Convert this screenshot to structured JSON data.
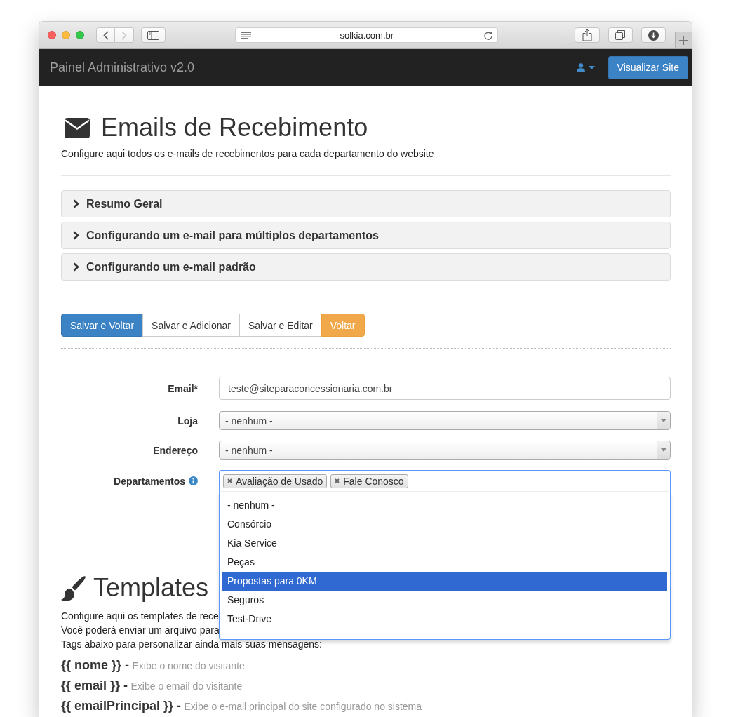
{
  "browser": {
    "url": "solkia.com.br",
    "forward_enabled": false
  },
  "navbar": {
    "brand": "Painel Administrativo v2.0",
    "button": "Visualizar Site"
  },
  "header": {
    "title": "Emails de Recebimento",
    "subtitle": "Configure aqui todos os e-mails de recebimentos para cada departamento do website"
  },
  "accordion": [
    {
      "label": "Resumo Geral",
      "expanded": false
    },
    {
      "label": "Configurando um e-mail para múltiplos departamentos",
      "expanded": false
    },
    {
      "label": "Configurando um e-mail padrão",
      "expanded": false
    }
  ],
  "actions": [
    {
      "label": "Salvar e Voltar",
      "kind": "primary"
    },
    {
      "label": "Salvar e Adicionar",
      "kind": "default"
    },
    {
      "label": "Salvar e Editar",
      "kind": "default"
    },
    {
      "label": "Voltar",
      "kind": "warning"
    }
  ],
  "form": [
    {
      "kind": "text",
      "label": "Email*",
      "value": "teste@siteparaconcessionaria.com.br"
    },
    {
      "kind": "select",
      "label": "Loja",
      "value": "- nenhum -"
    },
    {
      "kind": "select",
      "label": "Endereço",
      "value": "- nenhum -"
    },
    {
      "kind": "multiselect",
      "label": "Departamentos",
      "info": true,
      "open": true,
      "tags": [
        "Avaliação de Usado",
        "Fale Conosco"
      ],
      "options": [
        {
          "label": "- nenhum -",
          "selected": false
        },
        {
          "label": "Consórcio",
          "selected": false
        },
        {
          "label": "Kia Service",
          "selected": false
        },
        {
          "label": "Peças",
          "selected": false
        },
        {
          "label": "Propostas para 0KM",
          "selected": true
        },
        {
          "label": "Seguros",
          "selected": false
        },
        {
          "label": "Test-Drive",
          "selected": false
        }
      ]
    }
  ],
  "templates": {
    "title": "Templates",
    "lines": [
      "Configure aqui os templates de rece",
      "Você poderá enviar um arquivo para",
      "Tags abaixo para personalizar ainda mais suas mensagens:"
    ],
    "tags": [
      {
        "tag": "{{ nome }} -",
        "description": "Exibe o nome do visitante"
      },
      {
        "tag": "{{ email }} -",
        "description": "Exibe o email do visitante"
      },
      {
        "tag": "{{ emailPrincipal }} -",
        "description": "Exibe o e-mail principal do site configurado no sistema"
      }
    ]
  }
}
